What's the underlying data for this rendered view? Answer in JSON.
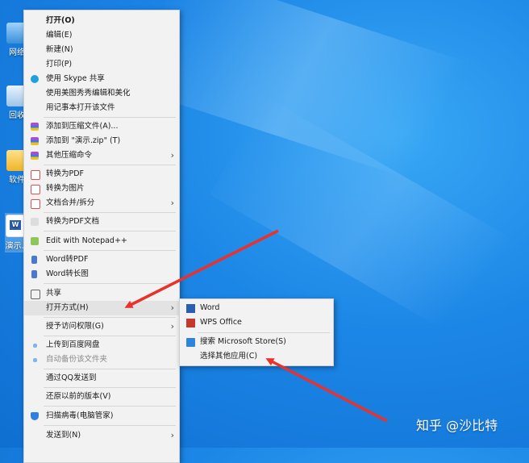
{
  "desktop": {
    "icons": [
      {
        "label": "网络",
        "icon": "network-icon"
      },
      {
        "label": "回收",
        "icon": "recycle-bin-icon"
      },
      {
        "label": "软件",
        "icon": "folder-icon"
      },
      {
        "label": "演示.c",
        "icon": "word-file-icon"
      }
    ],
    "watermark": "知乎 @沙比特"
  },
  "context_menu": {
    "items": [
      {
        "label": "打开(O)",
        "icon": null
      },
      {
        "label": "编辑(E)",
        "icon": null
      },
      {
        "label": "新建(N)",
        "icon": null
      },
      {
        "label": "打印(P)",
        "icon": null
      },
      {
        "label": "使用 Skype 共享",
        "icon": "skype-icon"
      },
      {
        "label": "使用美图秀秀编辑和美化",
        "icon": null
      },
      {
        "label": "用记事本打开该文件",
        "icon": null
      },
      {
        "label": "添加到压缩文件(A)...",
        "icon": "archive-icon"
      },
      {
        "label": "添加到 \"演示.zip\" (T)",
        "icon": "archive-icon"
      },
      {
        "label": "其他压缩命令",
        "icon": "archive-icon"
      },
      {
        "label": "转换为PDF",
        "icon": "pdf-icon"
      },
      {
        "label": "转换为图片",
        "icon": "image-convert-icon"
      },
      {
        "label": "文档合并/拆分",
        "icon": "merge-icon"
      },
      {
        "label": "转换为PDF文档",
        "icon": "pdf-doc-icon"
      },
      {
        "label": "Edit with Notepad++",
        "icon": "notepadpp-icon"
      },
      {
        "label": "Word转PDF",
        "icon": "word-pdf-icon"
      },
      {
        "label": "Word转长图",
        "icon": "word-image-icon"
      },
      {
        "label": "共享",
        "icon": "share-icon"
      },
      {
        "label": "打开方式(H)",
        "icon": null
      },
      {
        "label": "授予访问权限(G)",
        "icon": null
      },
      {
        "label": "上传到百度网盘",
        "icon": "baidu-upload-icon"
      },
      {
        "label": "自动备份该文件夹",
        "icon": "backup-icon"
      },
      {
        "label": "通过QQ发送到",
        "icon": null
      },
      {
        "label": "还原以前的版本(V)",
        "icon": null
      },
      {
        "label": "扫描病毒(电脑管家)",
        "icon": "shield-icon"
      },
      {
        "label": "发送到(N)",
        "icon": null
      }
    ]
  },
  "open_with_submenu": {
    "items": [
      {
        "label": "Word",
        "icon": "word-app-icon"
      },
      {
        "label": "WPS Office",
        "icon": "wps-icon"
      },
      {
        "label": "搜索 Microsoft Store(S)",
        "icon": "store-icon"
      },
      {
        "label": "选择其他应用(C)",
        "icon": null
      }
    ]
  },
  "colors": {
    "desktop_bg": "#1c86e6",
    "menu_bg": "#f2f2f2",
    "arrow_red": "#e8322b"
  }
}
